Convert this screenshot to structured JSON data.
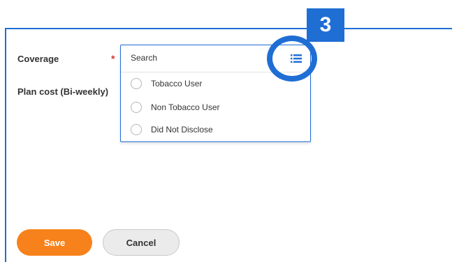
{
  "annotation": {
    "step_number": "3",
    "accent_color": "#1f6ed4"
  },
  "form": {
    "coverage_label": "Coverage",
    "required_marker": "*",
    "plan_cost_label": "Plan cost (Bi-weekly)"
  },
  "dropdown": {
    "search_placeholder": "Search",
    "list_icon": "list-icon",
    "options": [
      {
        "label": "Tobacco User",
        "selected": false
      },
      {
        "label": "Non Tobacco User",
        "selected": false
      },
      {
        "label": "Did Not Disclose",
        "selected": false
      }
    ]
  },
  "buttons": {
    "save_label": "Save",
    "save_color": "#f7821b",
    "cancel_label": "Cancel"
  }
}
